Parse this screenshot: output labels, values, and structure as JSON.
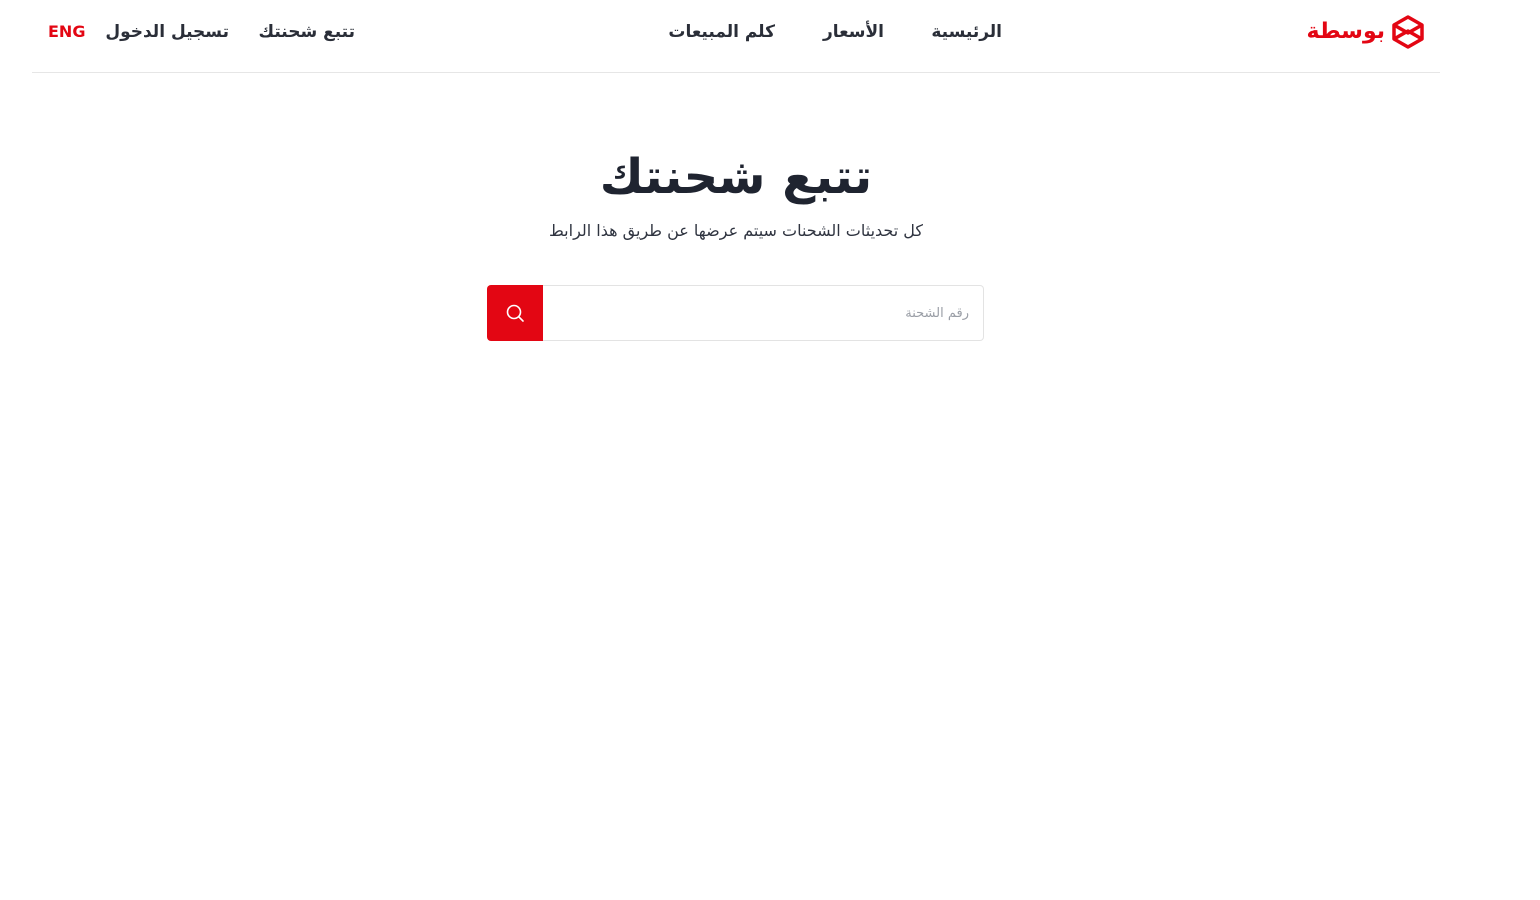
{
  "brand": {
    "name": "بوسطة",
    "accent_color": "#e30613"
  },
  "nav": {
    "home": "الرئيسية",
    "prices": "الأسعار",
    "contact_sales": "كلم المبيعات",
    "track_shipment": "تتبع شحنتك",
    "login": "تسجيل الدخول",
    "language": "ENG"
  },
  "hero": {
    "title": "تتبع شحنتك",
    "subtitle": "كل تحديثات الشحنات سيتم عرضها عن طريق هذا الرابط"
  },
  "search": {
    "placeholder": "رقم الشحنة",
    "value": "",
    "button_icon": "search-icon"
  }
}
